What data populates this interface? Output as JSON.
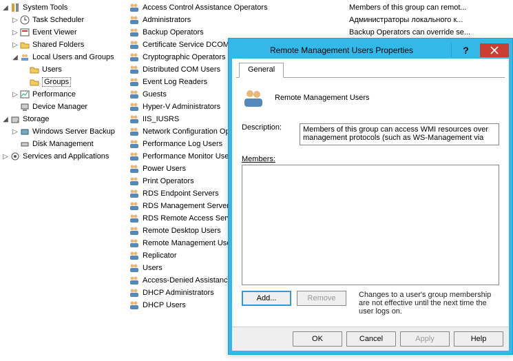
{
  "tree": {
    "system_tools": "System Tools",
    "task_scheduler": "Task Scheduler",
    "event_viewer": "Event Viewer",
    "shared_folders": "Shared Folders",
    "local_users_groups": "Local Users and Groups",
    "users": "Users",
    "groups": "Groups",
    "performance": "Performance",
    "device_manager": "Device Manager",
    "storage": "Storage",
    "windows_server_backup": "Windows Server Backup",
    "disk_management": "Disk Management",
    "services_apps": "Services and Applications"
  },
  "groups": [
    {
      "name": "Access Control Assistance Operators",
      "desc": "Members of this group can remot..."
    },
    {
      "name": "Administrators",
      "desc": "Администраторы локального к..."
    },
    {
      "name": "Backup Operators",
      "desc": "Backup Operators can override se..."
    },
    {
      "name": "Certificate Service DCOM Access",
      "desc": ""
    },
    {
      "name": "Cryptographic Operators",
      "desc": ""
    },
    {
      "name": "Distributed COM Users",
      "desc": ""
    },
    {
      "name": "Event Log Readers",
      "desc": ""
    },
    {
      "name": "Guests",
      "desc": ""
    },
    {
      "name": "Hyper-V Administrators",
      "desc": ""
    },
    {
      "name": "IIS_IUSRS",
      "desc": ""
    },
    {
      "name": "Network Configuration Operators",
      "desc": ""
    },
    {
      "name": "Performance Log Users",
      "desc": ""
    },
    {
      "name": "Performance Monitor Users",
      "desc": ""
    },
    {
      "name": "Power Users",
      "desc": ""
    },
    {
      "name": "Print Operators",
      "desc": ""
    },
    {
      "name": "RDS Endpoint Servers",
      "desc": ""
    },
    {
      "name": "RDS Management Servers",
      "desc": ""
    },
    {
      "name": "RDS Remote Access Servers",
      "desc": ""
    },
    {
      "name": "Remote Desktop Users",
      "desc": ""
    },
    {
      "name": "Remote Management Users",
      "desc": ""
    },
    {
      "name": "Replicator",
      "desc": ""
    },
    {
      "name": "Users",
      "desc": ""
    },
    {
      "name": "Access-Denied Assistance Users",
      "desc": ""
    },
    {
      "name": "DHCP Administrators",
      "desc": ""
    },
    {
      "name": "DHCP Users",
      "desc": ""
    }
  ],
  "dialog": {
    "title": "Remote Management Users Properties",
    "tab_general": "General",
    "group_name": "Remote Management Users",
    "description_label": "Description:",
    "description_value": "Members of this group can access WMI resources over management protocols (such as WS-Management via",
    "members_label": "Members:",
    "add_label": "Add...",
    "remove_label": "Remove",
    "note": "Changes to a user's group membership are not effective until the next time the user logs on.",
    "ok": "OK",
    "cancel": "Cancel",
    "apply": "Apply",
    "help": "Help"
  }
}
